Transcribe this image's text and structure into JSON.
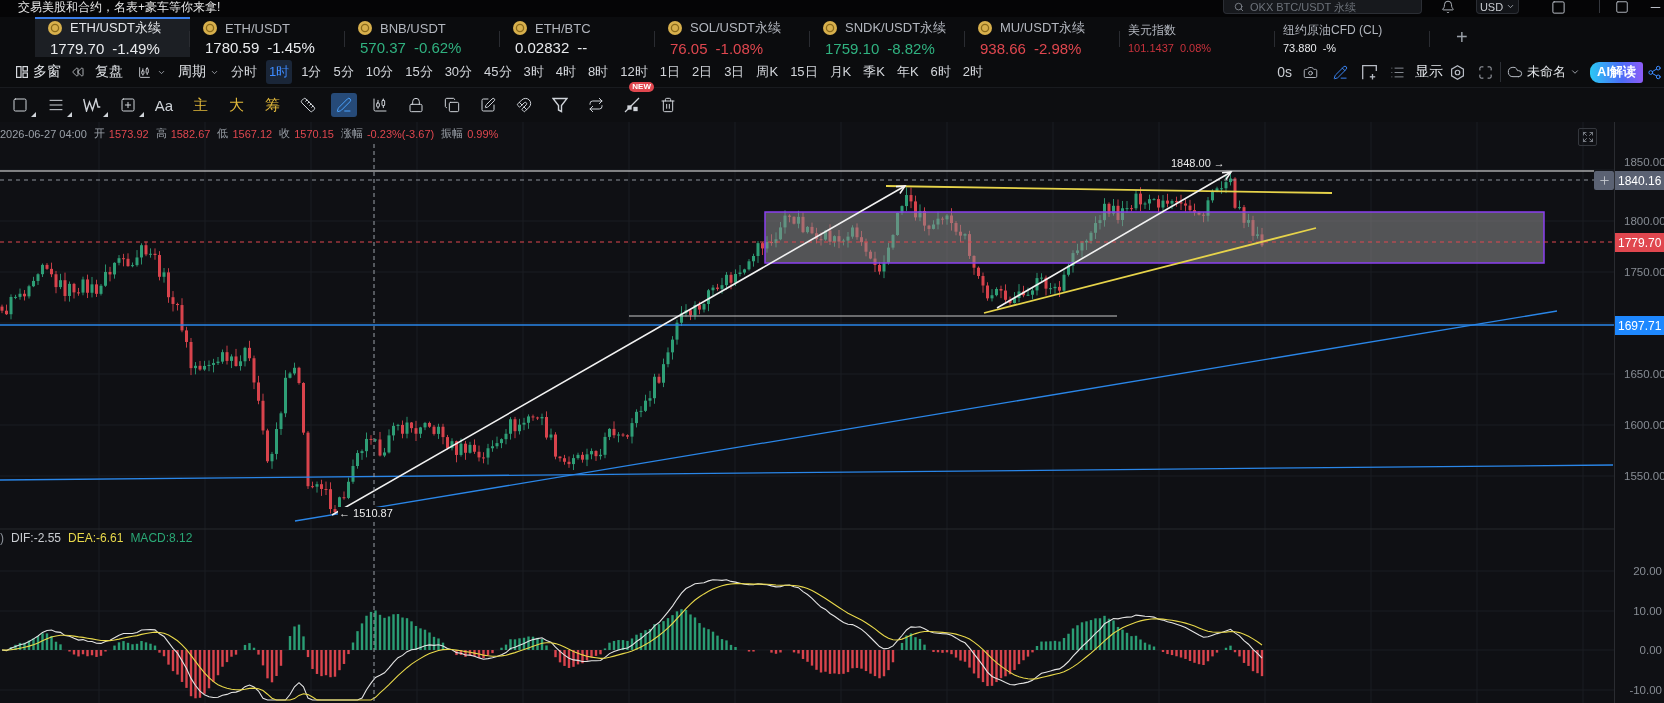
{
  "banner": {
    "text": "交易美股和合约，名表+豪车等你来拿!"
  },
  "header": {
    "search": {
      "placeholder": "OKX BTC/USDT 永续"
    },
    "currency": "USD"
  },
  "tabs": [
    {
      "kind": "coin",
      "name": "ETH/USDT永续",
      "price": "1779.70",
      "change": "-1.49%",
      "color": "#e8eaed",
      "selected": true
    },
    {
      "kind": "coin",
      "name": "ETH/USDT",
      "price": "1780.59",
      "change": "-1.45%",
      "color": "#e8eaed",
      "selected": false
    },
    {
      "kind": "coin",
      "name": "BNB/USDT",
      "price": "570.37",
      "change": "-0.62%",
      "color": "#30b280",
      "selected": false
    },
    {
      "kind": "coin",
      "name": "ETH/BTC",
      "price": "0.02832",
      "change": "--",
      "color": "#e8eaed",
      "selected": false
    },
    {
      "kind": "coin",
      "name": "SOL/USDT永续",
      "price": "76.05",
      "change": "-1.08%",
      "color": "#e0474f",
      "selected": false
    },
    {
      "kind": "coin",
      "name": "SNDK/USDT永续",
      "price": "1759.10",
      "change": "-8.82%",
      "color": "#30b280",
      "selected": false
    },
    {
      "kind": "coin",
      "name": "MU/USDT永续",
      "price": "938.66",
      "change": "-2.98%",
      "color": "#e0474f",
      "selected": false
    },
    {
      "kind": "index",
      "name": "美元指数",
      "price": "101.1437",
      "change": "0.08%",
      "color": "#c8323c",
      "selected": false
    },
    {
      "kind": "index",
      "name": "纽约原油CFD (CL)",
      "price": "73.880",
      "change": "-%",
      "color": "#e8eaed",
      "selected": false
    }
  ],
  "add_tab": "+",
  "period_bar": {
    "multi_window": "多窗",
    "replay": "复盘",
    "period": "周期",
    "periods": [
      {
        "label": "分时",
        "selected": false
      },
      {
        "label": "1时",
        "selected": true
      },
      {
        "label": "1分",
        "selected": false
      },
      {
        "label": "5分",
        "selected": false
      },
      {
        "label": "10分",
        "selected": false
      },
      {
        "label": "15分",
        "selected": false
      },
      {
        "label": "30分",
        "selected": false
      },
      {
        "label": "45分",
        "selected": false
      },
      {
        "label": "3时",
        "selected": false
      },
      {
        "label": "4时",
        "selected": false
      },
      {
        "label": "8时",
        "selected": false
      },
      {
        "label": "12时",
        "selected": false
      },
      {
        "label": "1日",
        "selected": false
      },
      {
        "label": "2日",
        "selected": false
      },
      {
        "label": "3日",
        "selected": false
      },
      {
        "label": "周K",
        "selected": false
      },
      {
        "label": "15日",
        "selected": false
      },
      {
        "label": "月K",
        "selected": false
      },
      {
        "label": "季K",
        "selected": false
      },
      {
        "label": "年K",
        "selected": false
      },
      {
        "label": "6时",
        "selected": false
      },
      {
        "label": "2时",
        "selected": false
      }
    ],
    "timer": "0s",
    "draw_mode_on": true,
    "display": "显示",
    "layout_name": "未命名",
    "ai_button": "AI解读"
  },
  "drawing_tools": [
    {
      "kind": "rectangle",
      "submenu": true,
      "selected": false
    },
    {
      "kind": "lines",
      "submenu": true,
      "selected": false
    },
    {
      "kind": "wave",
      "submenu": true,
      "selected": false
    },
    {
      "kind": "plus_box",
      "submenu": true,
      "selected": false
    },
    {
      "kind": "text",
      "label": "Aa",
      "submenu": false,
      "selected": false
    },
    {
      "kind": "indicator",
      "label": "主",
      "submenu": false,
      "selected": false
    },
    {
      "kind": "indicator",
      "label": "大",
      "submenu": false,
      "selected": false
    },
    {
      "kind": "indicator",
      "label": "筹",
      "submenu": false,
      "selected": false
    },
    {
      "kind": "ruler",
      "submenu": false,
      "selected": false
    },
    {
      "kind": "pen",
      "submenu": false,
      "selected": true
    },
    {
      "kind": "candles",
      "submenu": false,
      "selected": false
    },
    {
      "kind": "lock",
      "submenu": false,
      "selected": false
    },
    {
      "kind": "pages",
      "submenu": false,
      "selected": false
    },
    {
      "kind": "edit",
      "submenu": false,
      "selected": false
    },
    {
      "kind": "magnet",
      "submenu": false,
      "selected": false
    },
    {
      "kind": "filter",
      "submenu": false,
      "selected": false
    },
    {
      "kind": "switch",
      "submenu": false,
      "selected": false
    },
    {
      "kind": "line_tool",
      "badge": "NEW",
      "submenu": false,
      "selected": false
    },
    {
      "kind": "trash",
      "submenu": false,
      "selected": false
    }
  ],
  "chart": {
    "info": {
      "datetime": "2026-06-27 04:00",
      "fields": [
        {
          "label": "开",
          "value": "1573.92"
        },
        {
          "label": "高",
          "value": "1582.67"
        },
        {
          "label": "低",
          "value": "1567.12"
        },
        {
          "label": "收",
          "value": "1570.15"
        },
        {
          "label": "涨幅",
          "value": "-0.23%(-3.67)"
        },
        {
          "label": "振幅",
          "value": "0.99%"
        }
      ]
    },
    "annotations": [
      {
        "kind": "high",
        "text": "1848.00 →"
      },
      {
        "kind": "low",
        "text": "← 1510.87"
      }
    ],
    "price_axis": {
      "ticks": [
        "1850.00",
        "1800.00",
        "1750.00",
        "1650.00",
        "1600.00",
        "1550.00"
      ],
      "tags": [
        {
          "kind": "crosshair",
          "text": "1840.16"
        },
        {
          "kind": "last",
          "text": "1779.70"
        },
        {
          "kind": "line",
          "text": "1697.71"
        }
      ]
    }
  },
  "macd": {
    "params_tail": ")",
    "values": [
      {
        "kind": "dif",
        "text": "DIF:-2.55"
      },
      {
        "kind": "dea",
        "text": "DEA:-6.61"
      },
      {
        "kind": "macd",
        "text": "MACD:8.12"
      }
    ],
    "ticks": [
      "20.00",
      "10.00",
      "0.00",
      "-10.00"
    ]
  }
}
